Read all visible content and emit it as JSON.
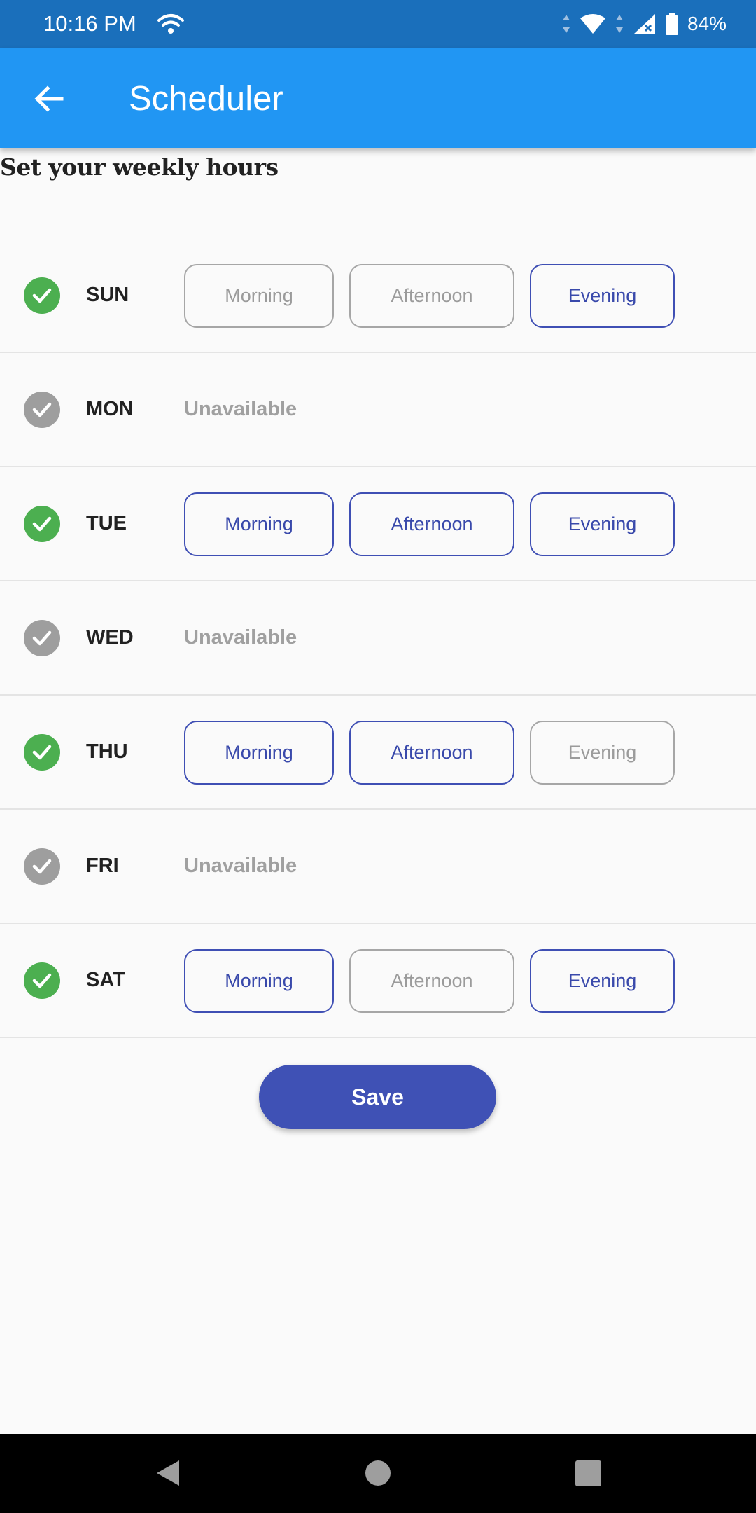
{
  "status_bar": {
    "time": "10:16 PM",
    "battery": "84%",
    "icons": [
      "wifi-icon",
      "data-arrows-icon",
      "wifi-full-icon",
      "signal-no-sim-icon",
      "battery-icon"
    ]
  },
  "app_bar": {
    "title": "Scheduler",
    "back_icon": "arrow-back-icon"
  },
  "heading": "Set your weekly hours",
  "slot_labels": {
    "morning": "Morning",
    "afternoon": "Afternoon",
    "evening": "Evening"
  },
  "unavailable_label": "Unavailable",
  "days": [
    {
      "label": "SUN",
      "enabled": true,
      "slots": {
        "morning": false,
        "afternoon": false,
        "evening": true
      }
    },
    {
      "label": "MON",
      "enabled": false
    },
    {
      "label": "TUE",
      "enabled": true,
      "slots": {
        "morning": true,
        "afternoon": true,
        "evening": true
      }
    },
    {
      "label": "WED",
      "enabled": false
    },
    {
      "label": "THU",
      "enabled": true,
      "slots": {
        "morning": true,
        "afternoon": true,
        "evening": false
      }
    },
    {
      "label": "FRI",
      "enabled": false
    },
    {
      "label": "SAT",
      "enabled": true,
      "slots": {
        "morning": true,
        "afternoon": false,
        "evening": true
      }
    }
  ],
  "save_label": "Save",
  "colors": {
    "status_bar": "#1a6fbb",
    "app_bar": "#2196f3",
    "accent": "#3f51b5",
    "check_on": "#4caf50",
    "check_off": "#9e9e9e",
    "slot_inactive": "#a6a6a6"
  }
}
